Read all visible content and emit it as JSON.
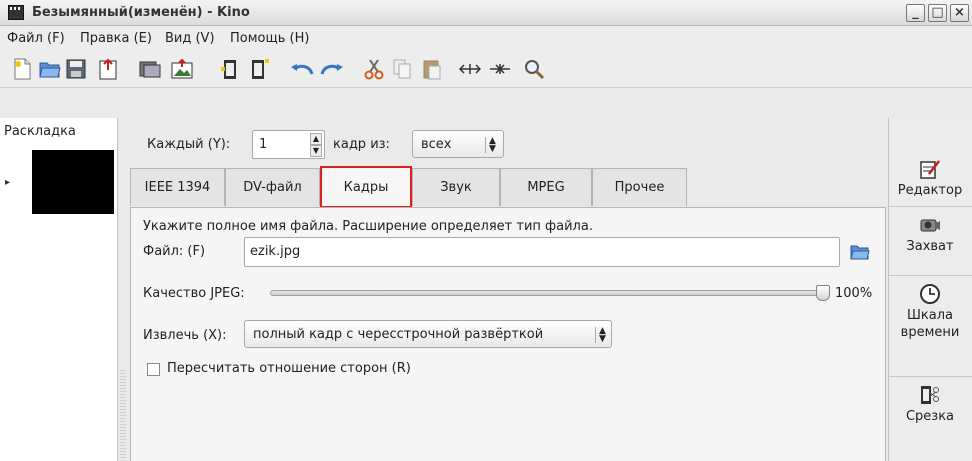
{
  "window": {
    "title": "Безымянный(изменён) - Kino",
    "controls": {
      "minimize": "_",
      "maximize": "□",
      "close": "×"
    }
  },
  "menubar": {
    "items": [
      {
        "label": "Файл (F)"
      },
      {
        "label": "Правка (E)"
      },
      {
        "label": "Вид (V)"
      },
      {
        "label": "Помощь (H)"
      }
    ]
  },
  "toolbar": {
    "icons": [
      "new-file-icon",
      "open-folder-icon",
      "save-icon",
      "export-icon",
      "capture-icon",
      "image-icon",
      "insert-frame-icon",
      "append-frame-icon",
      "undo-icon",
      "redo-icon",
      "cut-icon",
      "copy-icon",
      "paste-icon",
      "split-icon",
      "join-icon",
      "zoom-icon"
    ]
  },
  "left_panel": {
    "title": "Раскладка"
  },
  "every": {
    "label": "Каждый (Y):",
    "value": "1",
    "frames_label": "кадр из:",
    "frames_option": "всех"
  },
  "tabs": [
    {
      "label": "IEEE 1394"
    },
    {
      "label": "DV-файл"
    },
    {
      "label": "Кадры",
      "active": true
    },
    {
      "label": "Звук"
    },
    {
      "label": "MPEG"
    },
    {
      "label": "Прочее"
    }
  ],
  "frames_tab": {
    "hint": "Укажите полное имя файла. Расширение определяет тип файла.",
    "file_label": "Файл: (F)",
    "file_value": "ezik.jpg",
    "quality_label": "Качество JPEG:",
    "quality_value": "100%",
    "quality_fraction": 1.0,
    "extract_label": "Извлечь (X):",
    "extract_option": "полный кадр с чересстрочной развёрткой",
    "aspect_label": "Пересчитать отношение сторон (R)",
    "aspect_checked": false
  },
  "right_panel": {
    "buttons": [
      {
        "label": "Редактор",
        "icon": "editor-icon"
      },
      {
        "label": "Захват",
        "icon": "camera-icon"
      },
      {
        "label": "Шкала времени",
        "icon": "clock-icon"
      },
      {
        "label": "Срезка",
        "icon": "trim-icon"
      }
    ]
  },
  "colors": {
    "active_tab_border": "#e02020"
  }
}
